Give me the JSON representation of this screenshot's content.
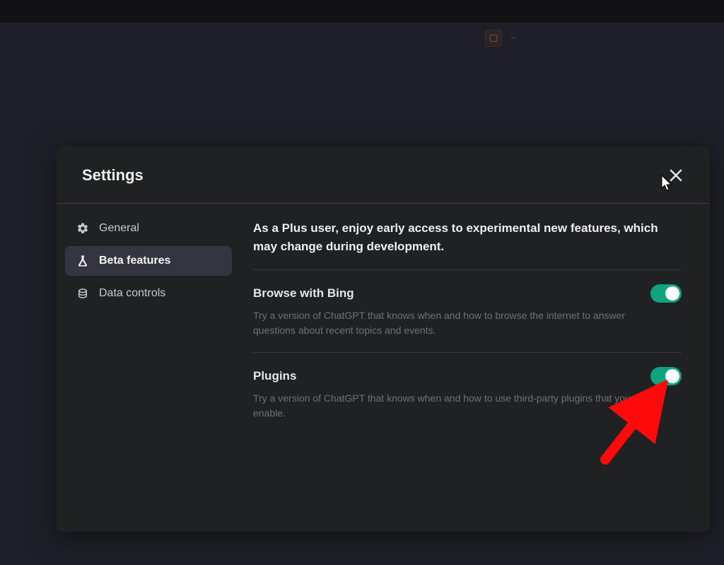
{
  "modal": {
    "title": "Settings"
  },
  "sidebar": {
    "items": [
      {
        "label": "General"
      },
      {
        "label": "Beta features"
      },
      {
        "label": "Data controls"
      }
    ]
  },
  "content": {
    "intro": "As a Plus user, enjoy early access to experimental new features, which may change during development.",
    "features": [
      {
        "title": "Browse with Bing",
        "desc": "Try a version of ChatGPT that knows when and how to browse the internet to answer questions about recent topics and events.",
        "enabled": true
      },
      {
        "title": "Plugins",
        "desc": "Try a version of ChatGPT that knows when and how to use third-party plugins that you enable.",
        "enabled": true
      }
    ]
  },
  "colors": {
    "accent": "#10a37f",
    "arrow": "#ff0a0a"
  }
}
